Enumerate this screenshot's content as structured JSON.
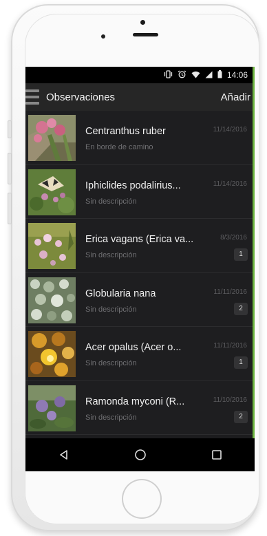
{
  "status_bar": {
    "time": "14:06",
    "icons": [
      "vibrate-icon",
      "alarm-icon",
      "wifi-icon",
      "signal-icon",
      "battery-icon"
    ]
  },
  "app_bar": {
    "title": "Observaciones",
    "add_label": "Añadir",
    "accent_color": "#6cb33f"
  },
  "observations": [
    {
      "name": "Centranthus ruber",
      "description": "En borde de camino",
      "date": "11/14/2016",
      "count": ""
    },
    {
      "name": "Iphiclides podalirius...",
      "description": "Sin descripción",
      "date": "11/14/2016",
      "count": ""
    },
    {
      "name": "Erica vagans (Erica va...",
      "description": "Sin descripción",
      "date": "8/3/2016",
      "count": "1"
    },
    {
      "name": "Globularia nana",
      "description": "Sin descripción",
      "date": "11/11/2016",
      "count": "2"
    },
    {
      "name": "Acer opalus (Acer o...",
      "description": "Sin descripción",
      "date": "11/11/2016",
      "count": "1"
    },
    {
      "name": "Ramonda myconi (R...",
      "description": "Sin descripción",
      "date": "11/10/2016",
      "count": "2"
    }
  ],
  "nav_bar": {
    "icons": [
      "back-icon",
      "home-icon",
      "recents-icon"
    ]
  }
}
